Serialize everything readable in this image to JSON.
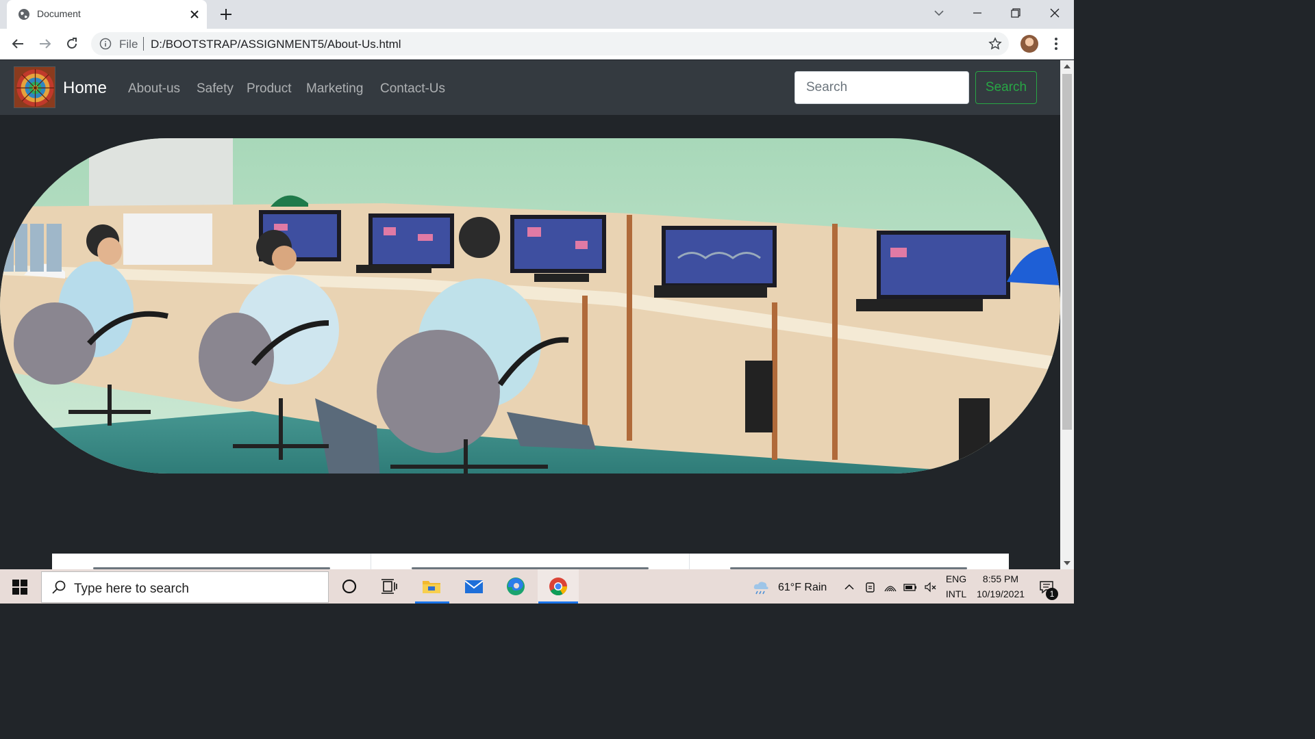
{
  "browser": {
    "tab_title": "Document",
    "url_scheme": "File",
    "url": "D:/BOOTSTRAP/ASSIGNMENT5/About-Us.html"
  },
  "navbar": {
    "brand": "Home",
    "links": [
      {
        "label": "About-us"
      },
      {
        "label": "Safety"
      },
      {
        "label": "Product"
      },
      {
        "label": "Marketing"
      },
      {
        "label": "Contact-Us"
      }
    ],
    "search_placeholder": "Search",
    "search_button": "Search"
  },
  "colors": {
    "navbar_bg": "#343a40",
    "page_bg": "#212529",
    "accent_green": "#28a745"
  },
  "taskbar": {
    "search_placeholder": "Type here to search",
    "weather": "61°F  Rain",
    "lang_top": "ENG",
    "lang_bottom": "INTL",
    "time": "8:55 PM",
    "date": "10/19/2021",
    "notification_count": "1"
  }
}
